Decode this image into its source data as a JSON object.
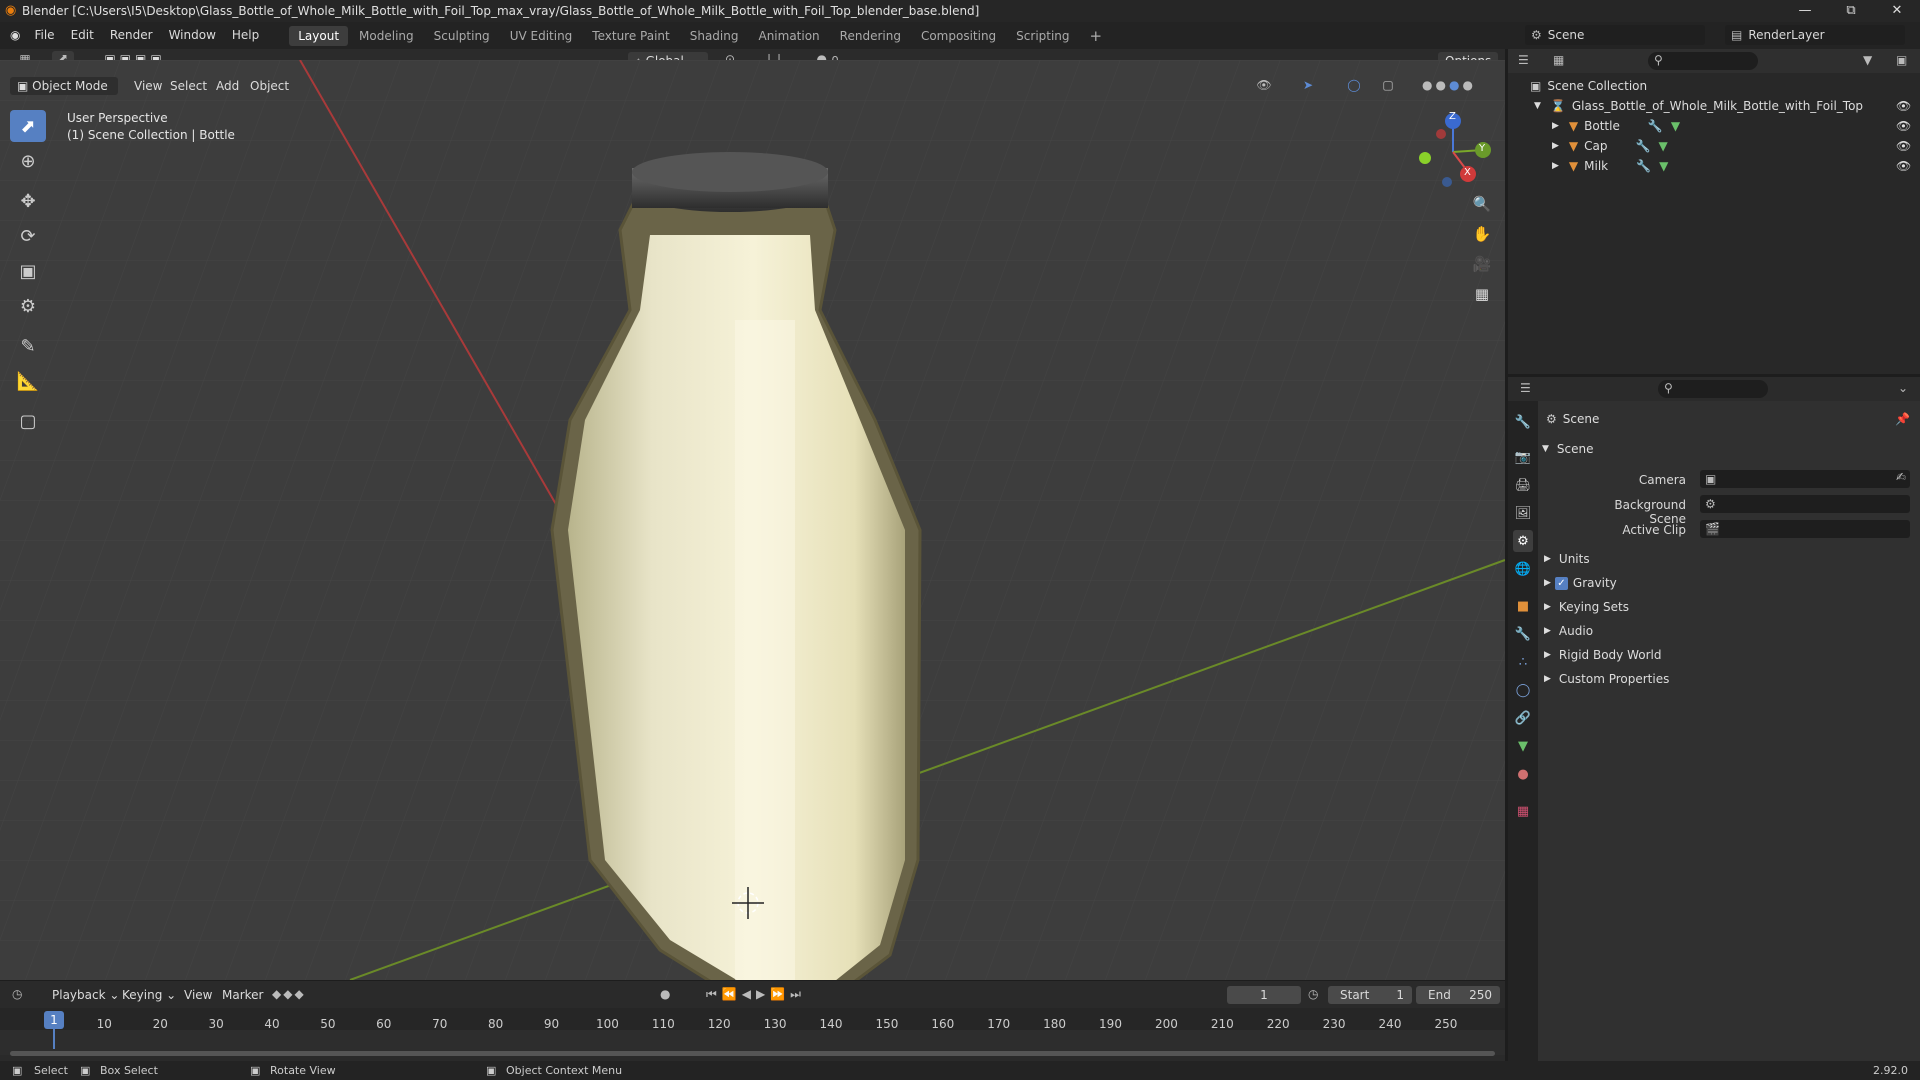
{
  "window": {
    "title": "Blender [C:\\Users\\I5\\Desktop\\Glass_Bottle_of_Whole_Milk_Bottle_with_Foil_Top_max_vray/Glass_Bottle_of_Whole_Milk_Bottle_with_Foil_Top_blender_base.blend]",
    "minimize_icon": "minimize-icon",
    "restore_icon": "restore-icon",
    "close_icon": "close-icon"
  },
  "menu": {
    "items": [
      "File",
      "Edit",
      "Render",
      "Window",
      "Help"
    ],
    "workspaces": [
      "Layout",
      "Modeling",
      "Sculpting",
      "UV Editing",
      "Texture Paint",
      "Shading",
      "Animation",
      "Rendering",
      "Compositing",
      "Scripting"
    ],
    "active_workspace": "Layout",
    "add_workspace": "+",
    "scene_name": "Scene",
    "view_layer": "RenderLayer"
  },
  "viewport_header": {
    "transform_orientation": "Global",
    "options_label": "Options",
    "mode": "Object Mode",
    "menus": [
      "View",
      "Select",
      "Add",
      "Object"
    ]
  },
  "viewport": {
    "perspective_label": "User Perspective",
    "collection_label": "(1) Scene Collection | Bottle",
    "gizmo_axes": {
      "x": "X",
      "y": "Y",
      "z": "Z"
    }
  },
  "outliner": {
    "root": "Scene Collection",
    "collection": "Glass_Bottle_of_Whole_Milk_Bottle_with_Foil_Top",
    "objects": [
      "Bottle",
      "Cap",
      "Milk"
    ]
  },
  "properties": {
    "context_label": "Scene",
    "panel_title": "Scene",
    "fields": [
      {
        "label": "Camera",
        "value": ""
      },
      {
        "label": "Background Scene",
        "value": ""
      },
      {
        "label": "Active Clip",
        "value": ""
      }
    ],
    "sections": [
      "Units",
      "Gravity",
      "Keying Sets",
      "Audio",
      "Rigid Body World",
      "Custom Properties"
    ],
    "gravity_checked": true
  },
  "timeline": {
    "menus": [
      "Playback",
      "Keying",
      "View",
      "Marker"
    ],
    "current_frame": "1",
    "start_label": "Start",
    "start_value": "1",
    "end_label": "End",
    "end_value": "250",
    "ticks": [
      "1",
      "10",
      "20",
      "30",
      "40",
      "50",
      "60",
      "70",
      "80",
      "90",
      "100",
      "110",
      "120",
      "130",
      "140",
      "150",
      "160",
      "170",
      "180",
      "190",
      "200",
      "210",
      "220",
      "230",
      "240",
      "250"
    ]
  },
  "statusbar": {
    "select": "Select",
    "box_select": "Box Select",
    "rotate_view": "Rotate View",
    "context_menu": "Object Context Menu",
    "version": "2.92.0"
  },
  "colors": {
    "accent": "#5680c2",
    "axis_x": "#c23a3a",
    "axis_y": "#7a9c2a",
    "object_orange": "#e0903a"
  }
}
